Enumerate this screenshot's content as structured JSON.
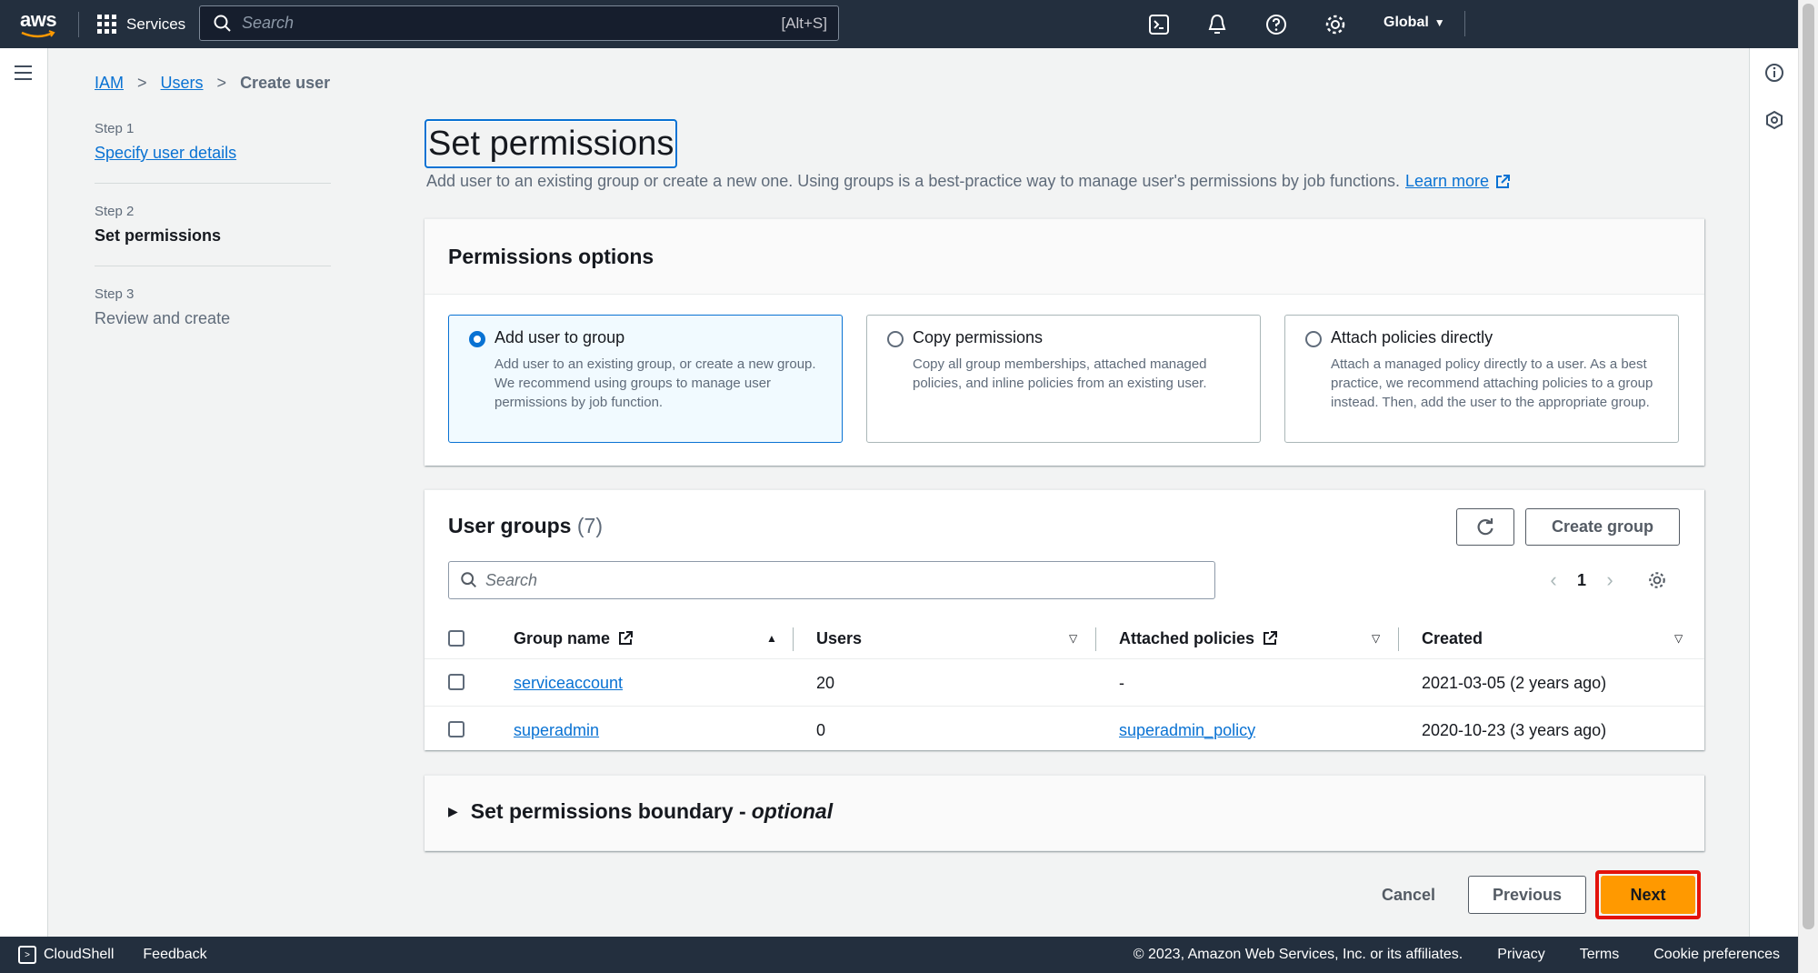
{
  "topnav": {
    "logo_text": "aws",
    "services_label": "Services",
    "search_placeholder": "Search",
    "search_shortcut": "[Alt+S]",
    "region_label": "Global"
  },
  "breadcrumb": {
    "items": [
      "IAM",
      "Users",
      "Create user"
    ]
  },
  "steps": [
    {
      "number": "Step 1",
      "title": "Specify user details"
    },
    {
      "number": "Step 2",
      "title": "Set permissions"
    },
    {
      "number": "Step 3",
      "title": "Review and create"
    }
  ],
  "page": {
    "title": "Set permissions",
    "description": "Add user to an existing group or create a new one. Using groups is a best-practice way to manage user's permissions by job functions.",
    "learn_more": "Learn more"
  },
  "permissions": {
    "header": "Permissions options",
    "options": [
      {
        "title": "Add user to group",
        "description": "Add user to an existing group, or create a new group. We recommend using groups to manage user permissions by job function.",
        "selected": true
      },
      {
        "title": "Copy permissions",
        "description": "Copy all group memberships, attached managed policies, and inline policies from an existing user.",
        "selected": false
      },
      {
        "title": "Attach policies directly",
        "description": "Attach a managed policy directly to a user. As a best practice, we recommend attaching policies to a group instead. Then, add the user to the appropriate group.",
        "selected": false
      }
    ]
  },
  "groups": {
    "title": "User groups",
    "count": "(7)",
    "create_label": "Create group",
    "search_placeholder": "Search",
    "page_number": "1",
    "columns": [
      "Group name",
      "Users",
      "Attached policies",
      "Created"
    ],
    "rows": [
      {
        "name": "serviceaccount",
        "users": "20",
        "policies": "-",
        "created": "2021-03-05 (2 years ago)"
      },
      {
        "name": "superadmin",
        "users": "0",
        "policies": "superadmin_policy",
        "created": "2020-10-23 (3 years ago)"
      }
    ]
  },
  "boundary": {
    "title": "Set permissions boundary -",
    "optional": "optional"
  },
  "actions": {
    "cancel": "Cancel",
    "previous": "Previous",
    "next": "Next"
  },
  "footer": {
    "cloudshell": "CloudShell",
    "feedback": "Feedback",
    "copyright": "© 2023, Amazon Web Services, Inc. or its affiliates.",
    "privacy": "Privacy",
    "terms": "Terms",
    "cookies": "Cookie preferences"
  },
  "colors": {
    "nav_bg": "#232f3e",
    "link": "#0972d3",
    "primary_button": "#ff9900",
    "highlight_border": "#e3120b"
  }
}
